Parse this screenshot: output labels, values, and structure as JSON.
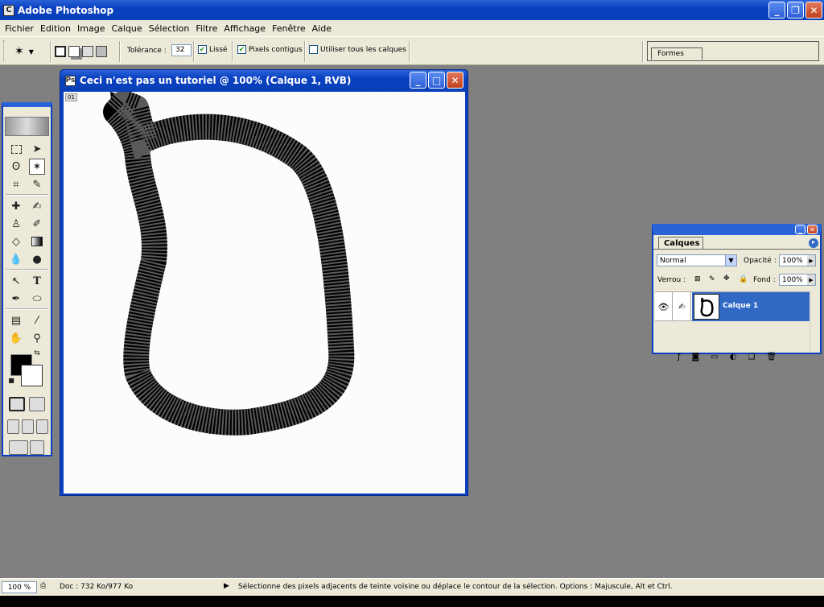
{
  "app": {
    "title": "Adobe Photoshop",
    "icon_letter": "C"
  },
  "menu": [
    "Fichier",
    "Edition",
    "Image",
    "Calque",
    "Sélection",
    "Filtre",
    "Affichage",
    "Fenêtre",
    "Aide"
  ],
  "options": {
    "tolerance_label": "Tolérance :",
    "tolerance_value": "32",
    "lisse_label": "Lissé",
    "lisse_checked": true,
    "contigus_label": "Pixels contigus",
    "contigus_checked": true,
    "all_layers_label": "Utiliser tous les calques",
    "all_layers_checked": false,
    "formes_tab": "Formes"
  },
  "document": {
    "title": "Ceci n'est pas un tutoriel @ 100% (Calque 1, RVB)",
    "ruler_label": "01"
  },
  "layers_panel": {
    "tab": "Calques",
    "blend_mode": "Normal",
    "opacity_label": "Opacité :",
    "opacity_value": "100%",
    "lock_label": "Verrou :",
    "fill_label": "Fond :",
    "fill_value": "100%",
    "layer_name": "Calque 1"
  },
  "status": {
    "zoom": "100 %",
    "doc_info": "Doc : 732 Ko/977 Ko",
    "hint": "Sélectionne des pixels adjacents de teinte voisine ou déplace le contour de la sélection. Options : Majuscule, Alt et Ctrl."
  },
  "colors": {
    "titlebar": "#0a3fc0",
    "selection": "#316ac5",
    "workspace": "#808080"
  }
}
